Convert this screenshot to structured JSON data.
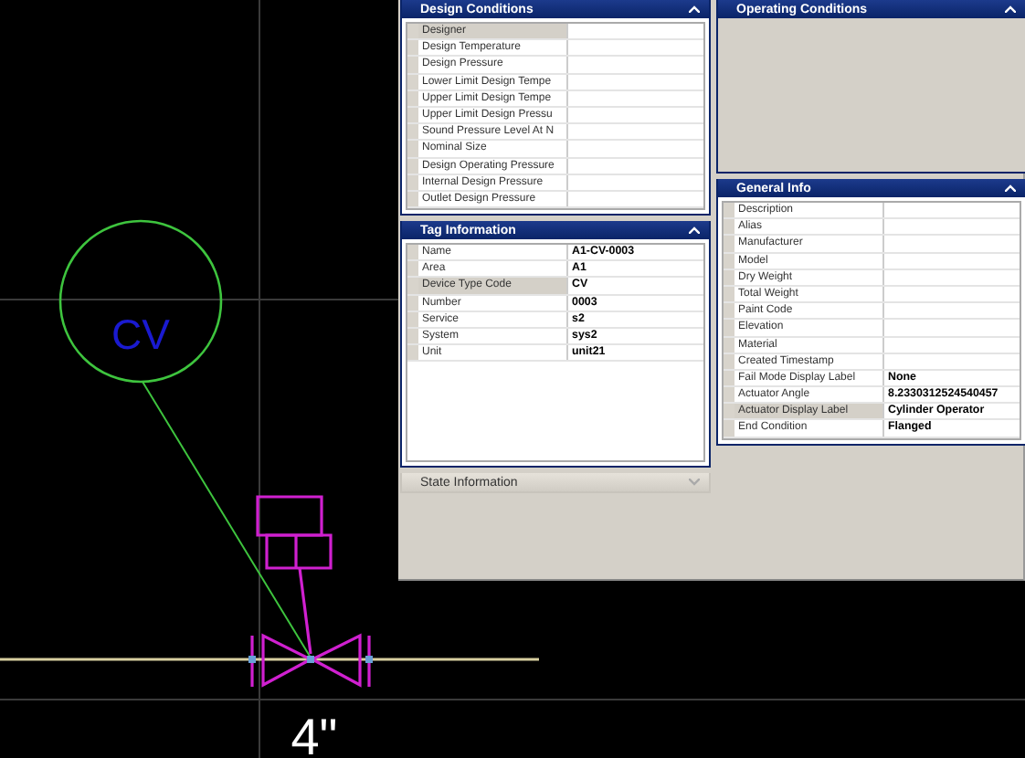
{
  "drawing": {
    "tag_label": "CV",
    "size_label": "4\""
  },
  "columns": [
    {
      "panels": [
        {
          "title": "Design Conditions",
          "expanded": true,
          "rows": [
            {
              "label": "Designer",
              "selected": true
            },
            {
              "label": "Design Temperature",
              "selected": false
            },
            {
              "label": "Design Pressure",
              "selected": false
            },
            {
              "label": "Lower Limit Design Tempe",
              "selected": false
            },
            {
              "label": "Upper Limit Design Tempe",
              "selected": false
            },
            {
              "label": "Upper Limit Design Pressu",
              "selected": false
            },
            {
              "label": "Sound Pressure Level At N",
              "selected": false
            },
            {
              "label": "Nominal Size",
              "selected": false
            },
            {
              "label": "Design Operating Pressure",
              "selected": false
            },
            {
              "label": "Internal Design Pressure",
              "selected": false
            },
            {
              "label": "Outlet Design Pressure",
              "selected": false
            }
          ]
        },
        {
          "title": "Tag Information",
          "expanded": true,
          "rows": [
            {
              "label": "Name",
              "value": "A1-CV-0003",
              "selected": false
            },
            {
              "label": "Area",
              "value": "A1",
              "selected": false
            },
            {
              "label": "Device Type Code",
              "value": "CV",
              "selected": true
            },
            {
              "label": "Number",
              "value": "0003",
              "selected": false
            },
            {
              "label": "Service",
              "value": "s2",
              "selected": false
            },
            {
              "label": "System",
              "value": "sys2",
              "selected": false
            },
            {
              "label": "Unit",
              "value": "unit21",
              "selected": false
            }
          ]
        },
        {
          "title": "State Information",
          "expanded": false
        }
      ]
    },
    {
      "panels": [
        {
          "title": "Operating Conditions",
          "expanded": true
        },
        {
          "title": "General Info",
          "expanded": true,
          "rows": [
            {
              "label": "Description",
              "selected": false
            },
            {
              "label": "Alias",
              "selected": false
            },
            {
              "label": "Manufacturer",
              "selected": false
            },
            {
              "label": "Model",
              "selected": false
            },
            {
              "label": "Dry Weight",
              "selected": false
            },
            {
              "label": "Total Weight",
              "selected": false
            },
            {
              "label": "Paint Code",
              "selected": false
            },
            {
              "label": "Elevation",
              "selected": false
            },
            {
              "label": "Material",
              "selected": false
            },
            {
              "label": "Created Timestamp",
              "selected": false
            },
            {
              "label": "Fail Mode Display Label",
              "value": "None",
              "selected": false
            },
            {
              "label": "Actuator Angle",
              "value": "8.2330312524540457",
              "selected": false
            },
            {
              "label": "Actuator Display Label",
              "value": "Cylinder Operator",
              "selected": true
            },
            {
              "label": "End Condition",
              "value": "Flanged",
              "selected": false
            }
          ]
        }
      ]
    }
  ]
}
